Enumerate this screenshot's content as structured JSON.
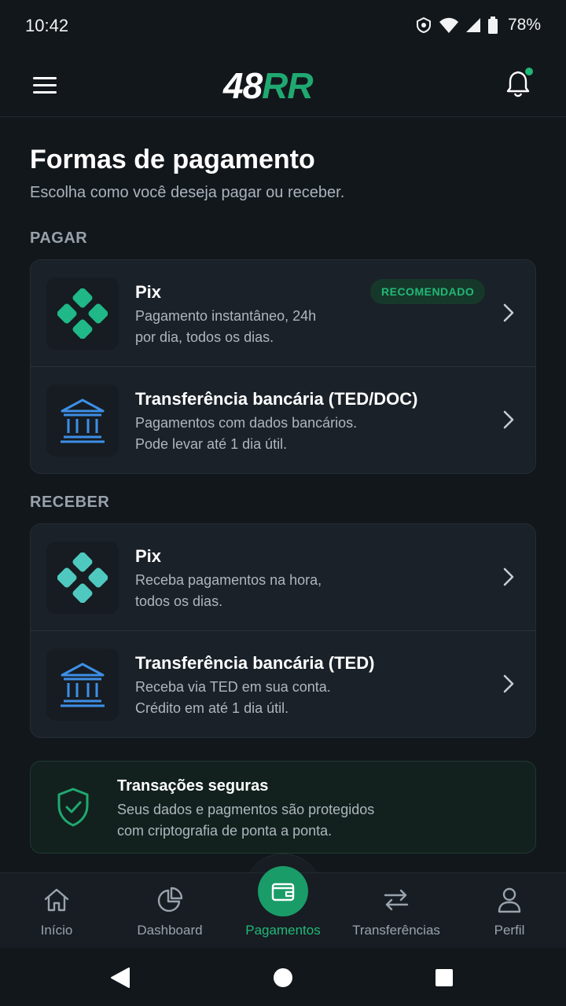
{
  "status_bar": {
    "time": "10:42",
    "battery": "78%"
  },
  "app": {
    "logo_white": "48",
    "logo_green": "RR"
  },
  "page": {
    "title": "Formas de pagamento",
    "subtitle": "Escolha como você deseja pagar ou receber."
  },
  "sections": {
    "pay": {
      "label": "PAGAR",
      "items": [
        {
          "title": "Pix",
          "badge": "RECOMENDADO",
          "desc": "Pagamento instantâneo, 24h\npor dia, todos os dias.",
          "icon": "pix-icon"
        },
        {
          "title": "Transferência bancária (TED/DOC)",
          "desc": "Pagamentos com dados bancários.\nPode levar até 1 dia útil.",
          "icon": "bank-icon"
        }
      ]
    },
    "receive": {
      "label": "RECEBER",
      "items": [
        {
          "title": "Pix",
          "desc": "Receba pagamentos na hora,\ntodos os dias.",
          "icon": "pix-icon"
        },
        {
          "title": "Transferência bancária (TED)",
          "desc": "Receba via TED em sua conta.\nCrédito em até 1 dia útil.",
          "icon": "bank-icon"
        }
      ]
    }
  },
  "secure": {
    "title": "Transações seguras",
    "desc": "Seus dados e pagmentos são protegidos\ncom criptografia de ponta a ponta."
  },
  "nav": {
    "items": [
      {
        "label": "Início",
        "icon": "home-icon"
      },
      {
        "label": "Dashboard",
        "icon": "pie-chart-icon"
      },
      {
        "label": "Pagamentos",
        "icon": "wallet-icon",
        "active": true
      },
      {
        "label": "Transferências",
        "icon": "transfer-icon"
      },
      {
        "label": "Perfil",
        "icon": "user-icon"
      }
    ]
  },
  "colors": {
    "accent": "#1fa971",
    "pix_green": "#1fb886",
    "pix_teal": "#4fc9bf",
    "bank_blue": "#3d8fe6",
    "background": "#12171c"
  }
}
